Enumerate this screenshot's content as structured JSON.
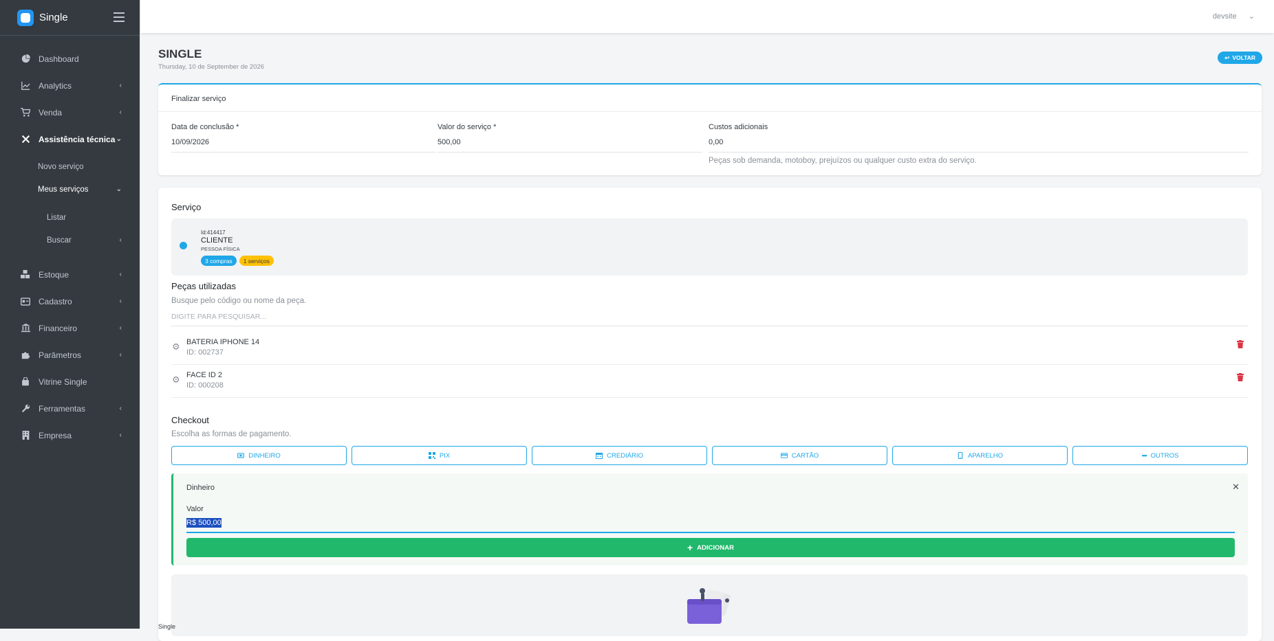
{
  "brand": {
    "name": "Single"
  },
  "sidebar": {
    "items": [
      {
        "label": "Dashboard"
      },
      {
        "label": "Analytics"
      },
      {
        "label": "Venda"
      },
      {
        "label": "Assistência técnica"
      },
      {
        "label": "Novo serviço"
      },
      {
        "label": "Meus serviços"
      },
      {
        "label": "Listar"
      },
      {
        "label": "Buscar"
      },
      {
        "label": "Estoque"
      },
      {
        "label": "Cadastro"
      },
      {
        "label": "Financeiro"
      },
      {
        "label": "Parâmetros"
      },
      {
        "label": "Vitrine Single"
      },
      {
        "label": "Ferramentas"
      },
      {
        "label": "Empresa"
      }
    ]
  },
  "topbar": {
    "user": "devsite"
  },
  "page": {
    "title": "SINGLE",
    "date": "Thursday, 10 de September de 2026",
    "back_label": "VOLTAR"
  },
  "finalize": {
    "title": "Finalizar serviço",
    "date_label": "Data de conclusão *",
    "date_value": "10/09/2026",
    "value_label": "Valor do serviço *",
    "value_value": "500,00",
    "extra_label": "Custos adicionais",
    "extra_value": "0,00",
    "extra_help": "Peças sob demanda, motoboy, prejuízos ou qualquer custo extra do serviço."
  },
  "service": {
    "title": "Serviço",
    "client": {
      "id": "Id:414417",
      "name": "CLIENTE",
      "type": "PESSOA FÍSICA",
      "badge_purchases": "3 compras",
      "badge_services": "1 serviços"
    },
    "parts_title": "Peças utilizadas",
    "parts_help": "Busque pelo código ou nome da peça.",
    "search_placeholder": "DIGITE PARA PESQUISAR...",
    "parts": [
      {
        "name": "BATERIA IPHONE 14",
        "id": "ID: 002737"
      },
      {
        "name": "FACE ID 2",
        "id": "ID: 000208"
      }
    ],
    "checkout_title": "Checkout",
    "checkout_help": "Escolha as formas de pagamento.",
    "pay_buttons": [
      "DINHEIRO",
      "PIX",
      "CREDIÁRIO",
      "CARTÃO",
      "APARELHO",
      "OUTROS"
    ],
    "payment": {
      "title": "Dinheiro",
      "value_label": "Valor",
      "value": "R$ 500,00",
      "add_label": "ADICIONAR"
    }
  },
  "footer": {
    "text": "Single"
  },
  "colors": {
    "accent": "#1fa7e8",
    "success": "#21b86c",
    "danger": "#dc3545",
    "sidebar": "#343a40"
  }
}
